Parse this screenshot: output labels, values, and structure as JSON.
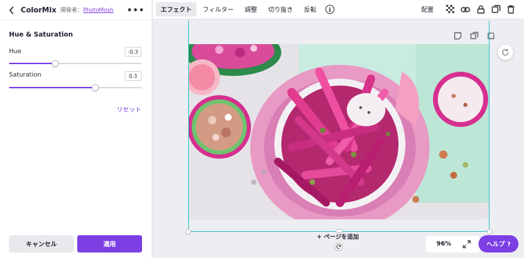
{
  "panel": {
    "app_name": "ColorMix",
    "developer_label": "開発者：",
    "developer_name": "PhotoMosh",
    "section_title": "Hue & Saturation",
    "controls": [
      {
        "label": "Hue",
        "value": "-0.3",
        "level": 0.35
      },
      {
        "label": "Saturation",
        "value": "0.3",
        "level": 0.65
      }
    ],
    "reset_label": "リセット",
    "cancel_label": "キャンセル",
    "apply_label": "適用"
  },
  "toolbar": {
    "items": [
      "エフェクト",
      "フィルター",
      "調整",
      "切り抜き",
      "反転"
    ],
    "info_glyph": "i",
    "position_label": "配置"
  },
  "canvas": {
    "add_page_label": "+ ページを追加",
    "zoom": "96%",
    "help_label": "ヘルプ ?"
  },
  "colors": {
    "accent": "#7b3fe4",
    "selection": "#2ec4c6"
  }
}
